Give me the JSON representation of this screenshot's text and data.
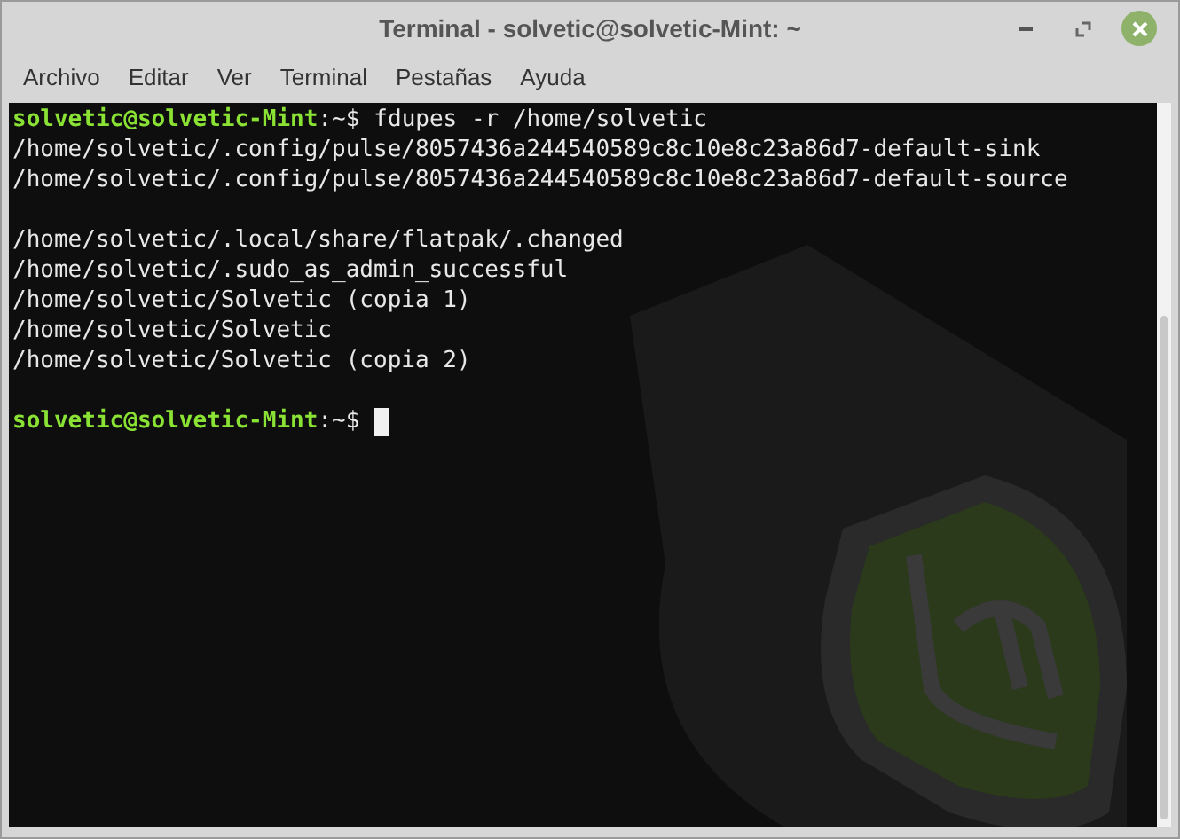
{
  "window": {
    "title": "Terminal - solvetic@solvetic-Mint: ~"
  },
  "menu": [
    "Archivo",
    "Editar",
    "Ver",
    "Terminal",
    "Pestañas",
    "Ayuda"
  ],
  "terminal": {
    "lines": [
      {
        "kind": "prompt",
        "user": "solvetic@solvetic-Mint",
        "path": ":~$",
        "command": "fdupes -r /home/solvetic",
        "cursor": false
      },
      {
        "kind": "output",
        "text": "/home/solvetic/.config/pulse/8057436a244540589c8c10e8c23a86d7-default-sink"
      },
      {
        "kind": "output",
        "text": "/home/solvetic/.config/pulse/8057436a244540589c8c10e8c23a86d7-default-source"
      },
      {
        "kind": "blank"
      },
      {
        "kind": "output",
        "text": "/home/solvetic/.local/share/flatpak/.changed"
      },
      {
        "kind": "output",
        "text": "/home/solvetic/.sudo_as_admin_successful"
      },
      {
        "kind": "output",
        "text": "/home/solvetic/Solvetic (copia 1)"
      },
      {
        "kind": "output",
        "text": "/home/solvetic/Solvetic"
      },
      {
        "kind": "output",
        "text": "/home/solvetic/Solvetic (copia 2)"
      },
      {
        "kind": "blank"
      },
      {
        "kind": "prompt",
        "user": "solvetic@solvetic-Mint",
        "path": ":~$",
        "cursor": true
      }
    ]
  }
}
